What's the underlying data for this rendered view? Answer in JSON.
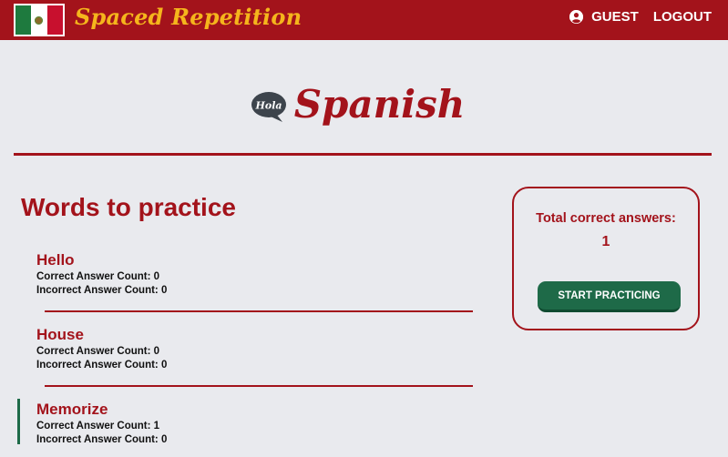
{
  "header": {
    "brand": "Spaced Repetition",
    "user_label": "GUEST",
    "logout_label": "LOGOUT",
    "flag_icon": "mexico-flag-icon",
    "user_icon": "user-circle-icon",
    "colors": {
      "bar": "#a3131b",
      "brand": "#f5b51c"
    }
  },
  "language": {
    "bubble_text": "Hola",
    "title": "Spanish"
  },
  "words_section": {
    "title": "Words to practice",
    "items": [
      {
        "word": "Hello",
        "correct_label": "Correct Answer Count: 0",
        "incorrect_label": "Incorrect Answer Count: 0"
      },
      {
        "word": "House",
        "correct_label": "Correct Answer Count: 0",
        "incorrect_label": "Incorrect Answer Count: 0"
      },
      {
        "word": "Memorize",
        "correct_label": "Correct Answer Count: 1",
        "incorrect_label": "Incorrect Answer Count: 0"
      }
    ]
  },
  "summary": {
    "label": "Total correct answers:",
    "total": "1",
    "button_label": "START PRACTICING",
    "colors": {
      "button": "#1e6a48"
    }
  }
}
